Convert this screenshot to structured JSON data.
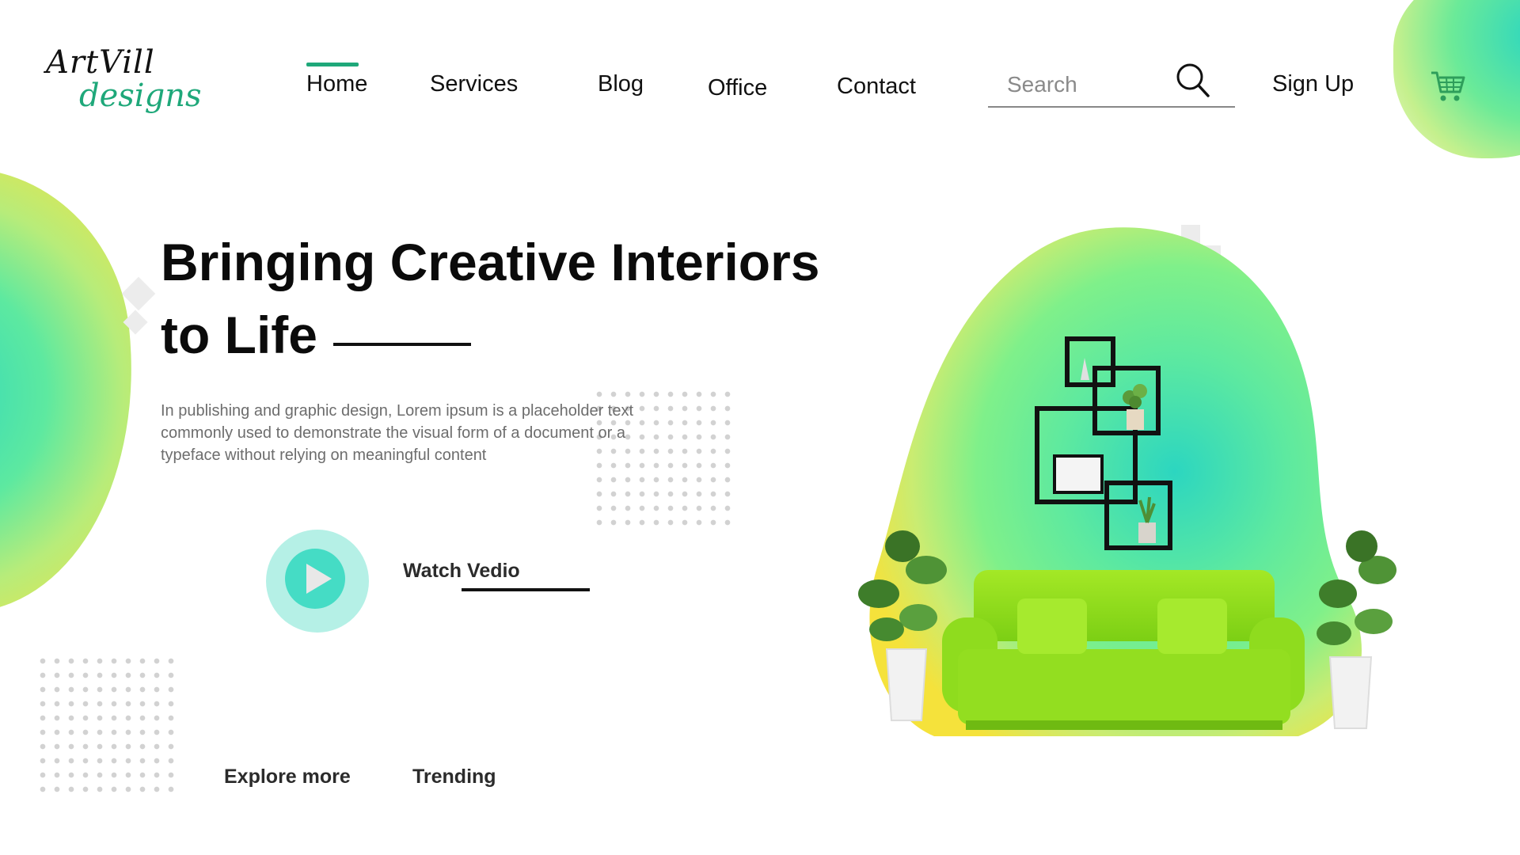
{
  "logo": {
    "line1": "ArtVill",
    "line2": "designs"
  },
  "nav": {
    "items": [
      {
        "label": "Home",
        "active": true
      },
      {
        "label": "Services"
      },
      {
        "label": "Blog"
      },
      {
        "label": "Office"
      },
      {
        "label": "Contact"
      }
    ]
  },
  "search": {
    "placeholder": "Search"
  },
  "signup_label": "Sign Up",
  "hero": {
    "title_line1": "Bringing Creative Interiors",
    "title_line2": "to Life",
    "description": "In publishing and graphic design, Lorem ipsum is a placeholder text commonly used to demonstrate the visual form of a document or a typeface without relying on meaningful content",
    "watch_label": "Watch Vedio"
  },
  "bottom_links": {
    "explore": "Explore more",
    "trending": "Trending"
  },
  "colors": {
    "accent": "#1fa87a",
    "teal": "#2cd6c0",
    "yellow": "#f5e23b",
    "sofa": "#8fdc1e"
  },
  "icons": [
    "search-icon",
    "cart-icon",
    "play-icon"
  ]
}
